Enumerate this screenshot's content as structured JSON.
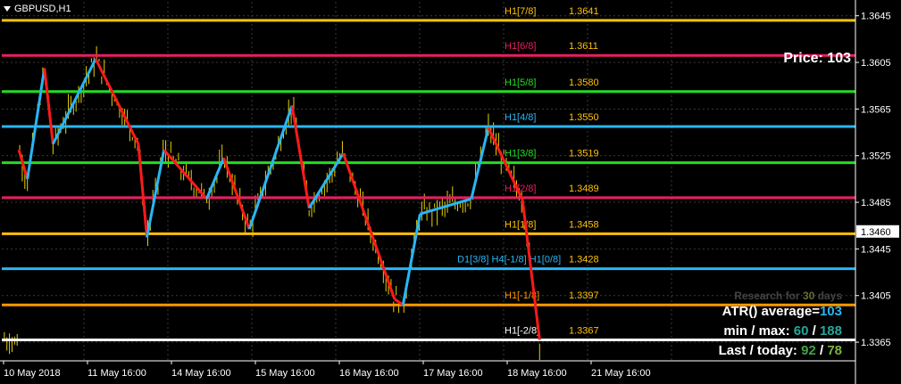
{
  "chart_data": {
    "type": "candlestick",
    "symbol_title": "GBPUSD,H1",
    "y_range": [
      1.3349,
      1.3657
    ],
    "y_ticks": [
      "1.3645",
      "1.3605",
      "1.3565",
      "1.3525",
      "1.3485",
      "1.3445",
      "1.3405",
      "1.3365"
    ],
    "current_price_tag": "1.3460",
    "x_labels": [
      "10 May 2018",
      "11 May 16:00",
      "14 May 16:00",
      "15 May 16:00",
      "16 May 16:00",
      "17 May 16:00",
      "18 May 16:00",
      "21 May 16:00"
    ],
    "murrey_levels": [
      {
        "label": "H1[7/8]",
        "value": "1.3641",
        "color": "#ffc107"
      },
      {
        "label": "H1[6/8]",
        "value": "1.3611",
        "color": "#e91e63"
      },
      {
        "label": "H1[5/8]",
        "value": "1.3580",
        "color": "#22dd22"
      },
      {
        "label": "H1[4/8]",
        "value": "1.3550",
        "color": "#29b6f6"
      },
      {
        "label": "H1[3/8]",
        "value": "1.3519",
        "color": "#22dd22"
      },
      {
        "label": "H1[2/8]",
        "value": "1.3489",
        "color": "#e91e63"
      },
      {
        "label": "H1[1/8]",
        "value": "1.3458",
        "color": "#ffc107"
      },
      {
        "label": "D1[3/8] H4[-1/8] H1[0/8]",
        "value": "1.3428",
        "color": "#29b6f6"
      },
      {
        "label": "H1[-1/8]",
        "value": "1.3397",
        "color": "#ff9800"
      },
      {
        "label": "H1[-2/8]",
        "value": "1.3367",
        "color": "#ffffff"
      }
    ],
    "zigzag_points": [
      [
        0.02,
        1.353
      ],
      [
        0.03,
        1.3505
      ],
      [
        0.05,
        1.36
      ],
      [
        0.06,
        1.3535
      ],
      [
        0.11,
        1.3608
      ],
      [
        0.16,
        1.3535
      ],
      [
        0.17,
        1.3455
      ],
      [
        0.19,
        1.353
      ],
      [
        0.24,
        1.3488
      ],
      [
        0.26,
        1.3523
      ],
      [
        0.29,
        1.3462
      ],
      [
        0.34,
        1.3568
      ],
      [
        0.36,
        1.348
      ],
      [
        0.4,
        1.3527
      ],
      [
        0.46,
        1.3402
      ],
      [
        0.47,
        1.3397
      ],
      [
        0.49,
        1.3475
      ],
      [
        0.55,
        1.3488
      ],
      [
        0.57,
        1.3549
      ],
      [
        0.61,
        1.3487
      ],
      [
        0.63,
        1.3367
      ]
    ],
    "price_label": "Price:",
    "price_value": "103",
    "research_label_a": "Research for",
    "research_days": "30",
    "research_label_b": "days",
    "atr_label_a": "ATR(",
    "atr_label_b": ") average=",
    "atr_average": "103",
    "minmax_label": "min / max:",
    "min_value": "60",
    "max_value": "188",
    "last_label": "Last / today:",
    "last_value": "92",
    "today_value": "78"
  }
}
